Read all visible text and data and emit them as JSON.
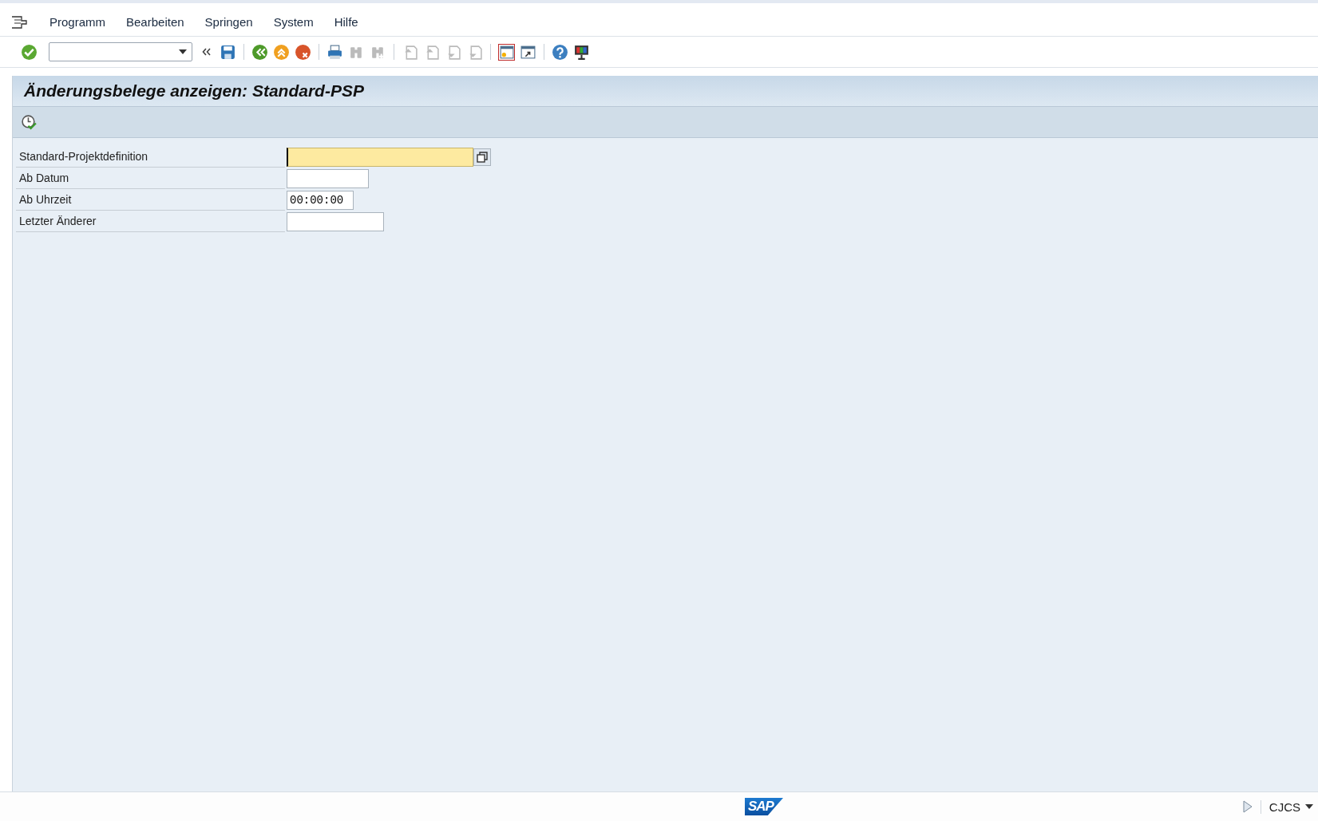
{
  "menu": [
    "Programm",
    "Bearbeiten",
    "Springen",
    "System",
    "Hilfe"
  ],
  "toolbar": [
    {
      "kind": "enter",
      "disabled": false
    },
    {
      "kind": "command-field"
    },
    {
      "kind": "save",
      "disabled": false
    },
    {
      "kind": "back",
      "disabled": false
    },
    {
      "kind": "exit",
      "disabled": false
    },
    {
      "kind": "cancel",
      "disabled": false
    },
    {
      "kind": "print",
      "disabled": false
    },
    {
      "kind": "find",
      "disabled": true
    },
    {
      "kind": "find-next",
      "disabled": true
    },
    {
      "kind": "first-page",
      "disabled": true
    },
    {
      "kind": "prev-page",
      "disabled": true
    },
    {
      "kind": "next-page",
      "disabled": true
    },
    {
      "kind": "last-page",
      "disabled": true
    },
    {
      "kind": "new-session",
      "disabled": false
    },
    {
      "kind": "shortcut",
      "disabled": false
    },
    {
      "kind": "help",
      "disabled": false
    },
    {
      "kind": "layout",
      "disabled": false
    }
  ],
  "title": "Änderungsbelege anzeigen: Standard-PSP",
  "fields": [
    {
      "label": "Standard-Projektdefinition",
      "kind": "long",
      "focused": true,
      "value_help": true
    },
    {
      "label": "Ab Datum",
      "kind": "date",
      "focused": false,
      "value_help": false
    },
    {
      "label": "Ab Uhrzeit",
      "kind": "time",
      "value": "00:00:00",
      "focused": false,
      "value_help": false
    },
    {
      "label": "Letzter Änderer",
      "kind": "user",
      "focused": false,
      "value_help": false
    }
  ],
  "status_bar": {
    "logo": "SAP",
    "transaction": "CJCS"
  }
}
